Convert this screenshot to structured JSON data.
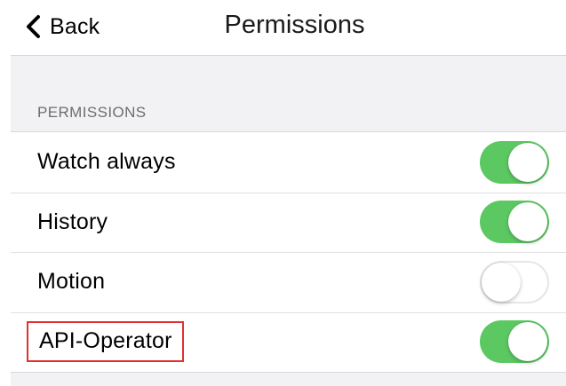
{
  "navbar": {
    "back_label": "Back",
    "back_icon": "chevron-left-icon",
    "title": "Permissions"
  },
  "section": {
    "header": "PERMISSIONS"
  },
  "colors": {
    "toggle_on": "#5bc862",
    "highlight_border": "#e03030",
    "grouped_background": "#f2f2f4"
  },
  "permissions": [
    {
      "label": "Watch always",
      "enabled": true
    },
    {
      "label": "History",
      "enabled": true
    },
    {
      "label": "Motion",
      "enabled": false
    },
    {
      "label": "API-Operator",
      "enabled": true,
      "highlighted": true
    }
  ]
}
